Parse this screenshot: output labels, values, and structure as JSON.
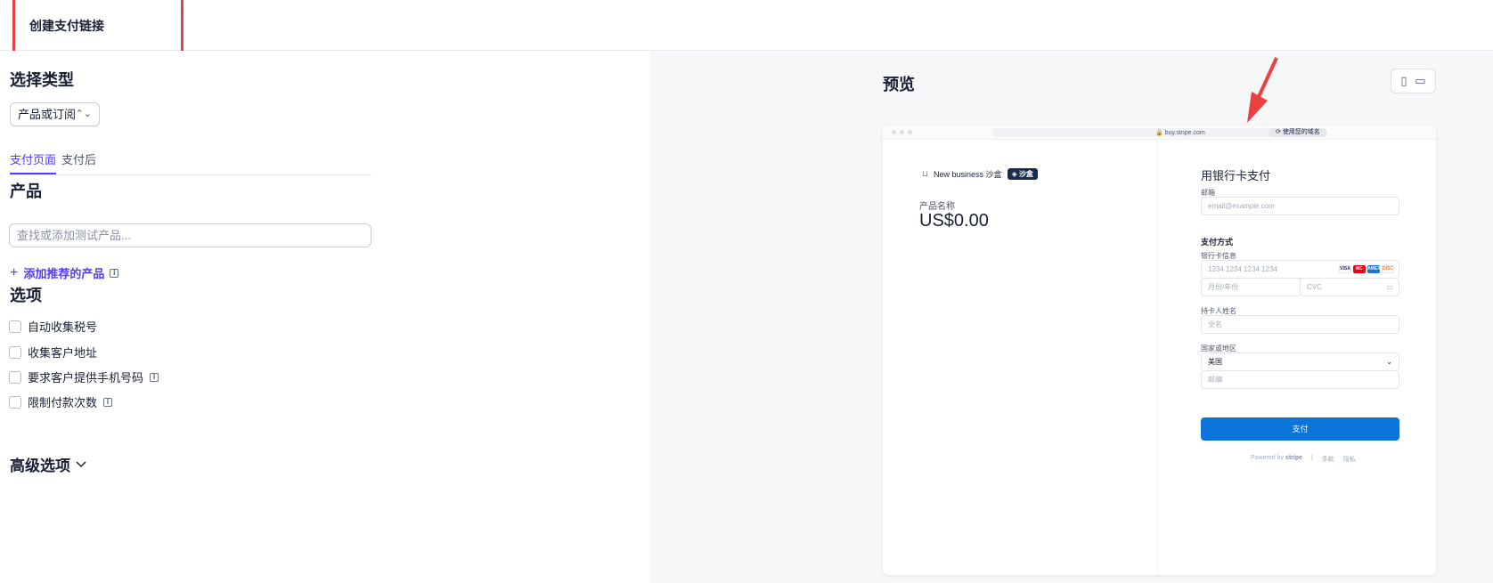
{
  "header": {
    "title": "创建支付链接"
  },
  "left": {
    "select_type_heading": "选择类型",
    "type_select_value": "产品或订阅",
    "tabs": [
      {
        "label": "支付页面"
      },
      {
        "label": "支付后"
      }
    ],
    "product_heading": "产品",
    "product_search_placeholder": "查找或添加测试产品...",
    "add_recommended": "添加推荐的产品",
    "options_heading": "选项",
    "options": [
      {
        "label": "自动收集税号"
      },
      {
        "label": "收集客户地址"
      },
      {
        "label": "要求客户提供手机号码"
      },
      {
        "label": "限制付款次数"
      }
    ],
    "advanced": "高级选项"
  },
  "preview": {
    "title": "预览",
    "url": "buy.stripe.com",
    "domain_chip": "使用您的域名",
    "business_name": "New business 沙盒",
    "sandbox_badge": "沙盒",
    "product_label": "产品名称",
    "price": "US$0.00",
    "pay_title": "用银行卡支付",
    "email_label": "邮箱",
    "email_placeholder": "email@example.com",
    "payment_method": "支付方式",
    "card_info_label": "银行卡信息",
    "card_number_placeholder": "1234 1234 1234 1234",
    "expiry_placeholder": "月份/年份",
    "cvc_placeholder": "CVC",
    "cardholder_label": "持卡人姓名",
    "cardholder_placeholder": "全名",
    "country_label": "国家或地区",
    "country_value": "美国",
    "postal_placeholder": "邮编",
    "pay_button": "支付",
    "powered_by": "Powered by",
    "stripe": "stripe",
    "terms": "条款",
    "privacy": "隐私",
    "card_brands": [
      "VISA",
      "MC",
      "AMEX",
      "DISC"
    ]
  },
  "colors": {
    "accent": "#533afd",
    "pay_button": "#0d74da",
    "annotation_red": "#e8413f"
  }
}
